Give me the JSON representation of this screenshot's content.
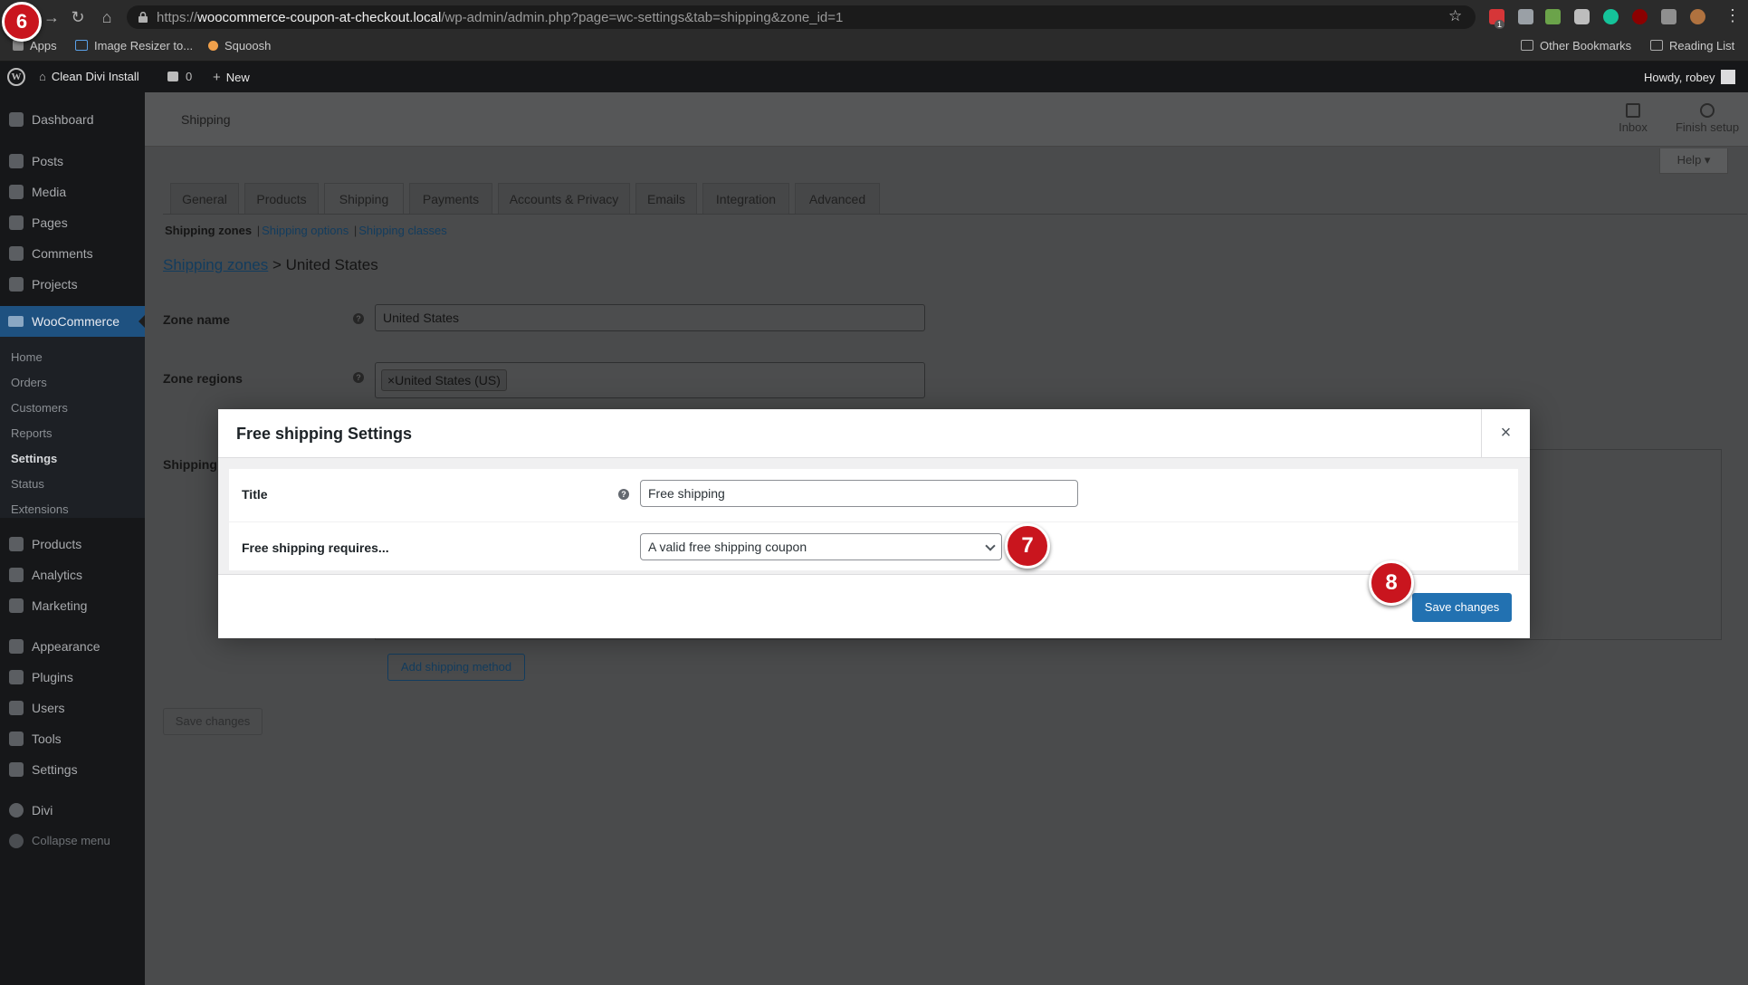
{
  "browser": {
    "url_scheme": "https://",
    "url_host": "woocommerce-coupon-at-checkout.local",
    "url_path": "/wp-admin/admin.php?page=wc-settings&tab=shipping&zone_id=1",
    "bookmarks": [
      "Apps",
      "Image Resizer to...",
      "Squoosh"
    ],
    "other_bookmarks": "Other Bookmarks",
    "reading_list": "Reading List",
    "ext_badge": "1"
  },
  "adminbar": {
    "logo": "W",
    "site_name": "Clean Divi Install",
    "comments_count": "0",
    "new_label": "New",
    "howdy": "Howdy, robey"
  },
  "sidebar": {
    "items": [
      "Dashboard",
      "Posts",
      "Media",
      "Pages",
      "Comments",
      "Projects"
    ],
    "woocommerce": "WooCommerce",
    "woo_sub": [
      "Home",
      "Orders",
      "Customers",
      "Reports",
      "Settings",
      "Status",
      "Extensions"
    ],
    "items_after": [
      "Products",
      "Analytics",
      "Marketing",
      "Appearance",
      "Plugins",
      "Users",
      "Tools",
      "Settings",
      "Divi",
      "Collapse menu"
    ]
  },
  "header": {
    "title": "Shipping",
    "inbox": "Inbox",
    "finish_setup": "Finish setup",
    "help": "Help ▾"
  },
  "tabs": [
    "General",
    "Products",
    "Shipping",
    "Payments",
    "Accounts & Privacy",
    "Emails",
    "Integration",
    "Advanced"
  ],
  "subnav": {
    "current": "Shipping zones",
    "options": "Shipping options",
    "classes": "Shipping classes",
    "sep": "|"
  },
  "breadcrumb": {
    "link": "Shipping zones",
    "sep": " > ",
    "current": "United States"
  },
  "zone": {
    "name_label": "Zone name",
    "name_value": "United States",
    "regions_label": "Zone regions",
    "region_chip": "×United States (US)",
    "methods_label": "Shipping",
    "add_method": "Add shipping method",
    "save": "Save changes",
    "help": "?"
  },
  "modal": {
    "title": "Free shipping Settings",
    "close": "×",
    "title_label": "Title",
    "title_value": "Free shipping",
    "requires_label": "Free shipping requires...",
    "requires_value": "A valid free shipping coupon",
    "save": "Save changes",
    "help": "?"
  },
  "steps": [
    "6",
    "7",
    "8"
  ]
}
